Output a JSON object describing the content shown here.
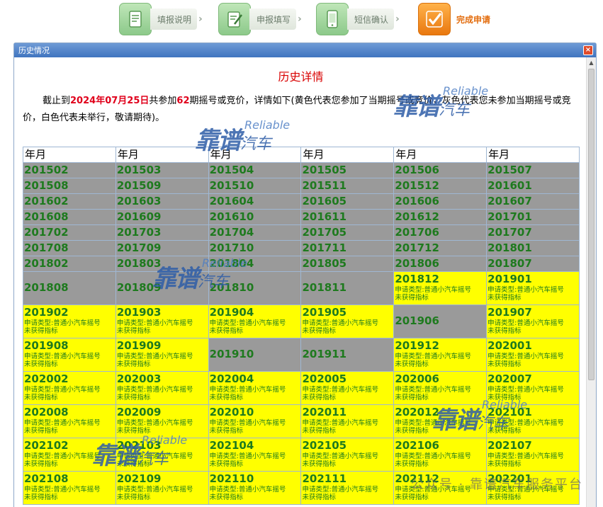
{
  "steps": [
    {
      "label": "填报说明"
    },
    {
      "label": "申报填写"
    },
    {
      "label": "短信确认"
    },
    {
      "label": "完成申请"
    }
  ],
  "window": {
    "title": "历史情况",
    "close": "×"
  },
  "detail": {
    "title": "历史详情",
    "intro_prefix": "截止到",
    "date": "2024年07月25日",
    "intro_mid": "共参加",
    "count": "62",
    "intro_suffix": "期摇号或竞价，详情如下(黄色代表您参加了当期摇号或竞价，灰色代表您未参加当期摇号或竞价，白色代表未举行，敬请期待)。"
  },
  "table": {
    "header": [
      "年月",
      "年月",
      "年月",
      "年月",
      "年月",
      "年月"
    ],
    "note_line1": "申请类型:普通小汽车摇号",
    "note_line2": "未获得指标",
    "rows": [
      {
        "tall": false,
        "cells": [
          [
            "201502",
            "g"
          ],
          [
            "201503",
            "g"
          ],
          [
            "201504",
            "g"
          ],
          [
            "201505",
            "g"
          ],
          [
            "201506",
            "g"
          ],
          [
            "201507",
            "g"
          ]
        ]
      },
      {
        "tall": false,
        "cells": [
          [
            "201508",
            "g"
          ],
          [
            "201509",
            "g"
          ],
          [
            "201510",
            "g"
          ],
          [
            "201511",
            "g"
          ],
          [
            "201512",
            "g"
          ],
          [
            "201601",
            "g"
          ]
        ]
      },
      {
        "tall": false,
        "cells": [
          [
            "201602",
            "g"
          ],
          [
            "201603",
            "g"
          ],
          [
            "201604",
            "g"
          ],
          [
            "201605",
            "g"
          ],
          [
            "201606",
            "g"
          ],
          [
            "201607",
            "g"
          ]
        ]
      },
      {
        "tall": false,
        "cells": [
          [
            "201608",
            "g"
          ],
          [
            "201609",
            "g"
          ],
          [
            "201610",
            "g"
          ],
          [
            "201611",
            "g"
          ],
          [
            "201612",
            "g"
          ],
          [
            "201701",
            "g"
          ]
        ]
      },
      {
        "tall": false,
        "cells": [
          [
            "201702",
            "g"
          ],
          [
            "201703",
            "g"
          ],
          [
            "201704",
            "g"
          ],
          [
            "201705",
            "g"
          ],
          [
            "201706",
            "g"
          ],
          [
            "201707",
            "g"
          ]
        ]
      },
      {
        "tall": false,
        "cells": [
          [
            "201708",
            "g"
          ],
          [
            "201709",
            "g"
          ],
          [
            "201710",
            "g"
          ],
          [
            "201711",
            "g"
          ],
          [
            "201712",
            "g"
          ],
          [
            "201801",
            "g"
          ]
        ]
      },
      {
        "tall": false,
        "cells": [
          [
            "201802",
            "g"
          ],
          [
            "201803",
            "g"
          ],
          [
            "201804",
            "g"
          ],
          [
            "201805",
            "g"
          ],
          [
            "201806",
            "g"
          ],
          [
            "201807",
            "g"
          ]
        ]
      },
      {
        "tall": true,
        "cells": [
          [
            "201808",
            "g"
          ],
          [
            "201809",
            "g"
          ],
          [
            "201810",
            "g"
          ],
          [
            "201811",
            "g"
          ],
          [
            "201812",
            "y"
          ],
          [
            "201901",
            "y"
          ]
        ]
      },
      {
        "tall": true,
        "cells": [
          [
            "201902",
            "y"
          ],
          [
            "201903",
            "y"
          ],
          [
            "201904",
            "y"
          ],
          [
            "201905",
            "y"
          ],
          [
            "201906",
            "g"
          ],
          [
            "201907",
            "y"
          ]
        ]
      },
      {
        "tall": true,
        "cells": [
          [
            "201908",
            "y"
          ],
          [
            "201909",
            "y"
          ],
          [
            "201910",
            "g"
          ],
          [
            "201911",
            "g"
          ],
          [
            "201912",
            "y"
          ],
          [
            "202001",
            "y"
          ]
        ]
      },
      {
        "tall": true,
        "cells": [
          [
            "202002",
            "y"
          ],
          [
            "202003",
            "y"
          ],
          [
            "202004",
            "y"
          ],
          [
            "202005",
            "y"
          ],
          [
            "202006",
            "y"
          ],
          [
            "202007",
            "y"
          ]
        ]
      },
      {
        "tall": true,
        "cells": [
          [
            "202008",
            "y"
          ],
          [
            "202009",
            "y"
          ],
          [
            "202010",
            "y"
          ],
          [
            "202011",
            "y"
          ],
          [
            "202012",
            "y"
          ],
          [
            "202101",
            "y"
          ]
        ]
      },
      {
        "tall": true,
        "cells": [
          [
            "202102",
            "y"
          ],
          [
            "202103",
            "y"
          ],
          [
            "202104",
            "y"
          ],
          [
            "202105",
            "y"
          ],
          [
            "202106",
            "y"
          ],
          [
            "202107",
            "y"
          ]
        ]
      },
      {
        "tall": true,
        "cells": [
          [
            "202108",
            "y"
          ],
          [
            "202109",
            "y"
          ],
          [
            "202110",
            "y"
          ],
          [
            "202111",
            "y"
          ],
          [
            "202112",
            "y"
          ],
          [
            "202201",
            "y"
          ]
        ]
      }
    ]
  },
  "watermark": {
    "main": "靠谱",
    "sub": "汽车",
    "en": "Reliable"
  },
  "footer": {
    "text": "公众号 · 靠谱汽车服务平台"
  },
  "colors": {
    "gray_cell": "#9a9a9a",
    "yellow_cell": "#ffff00",
    "month_text": "#1e7a1e",
    "title_red": "#d90000",
    "title_bar": "#3f74bf"
  }
}
